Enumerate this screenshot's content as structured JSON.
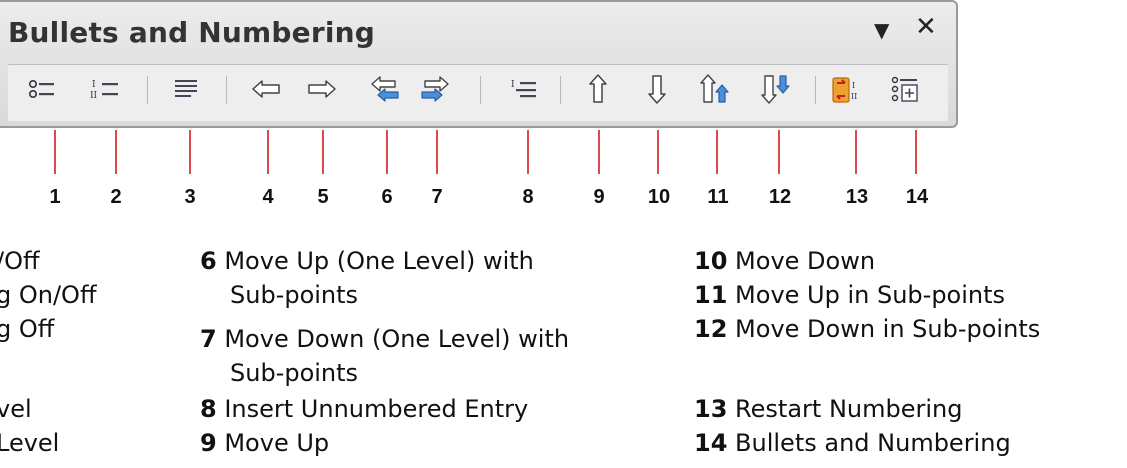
{
  "toolbar": {
    "title": "Bullets and Numbering",
    "menu_icon": "triangle-down-icon",
    "close_icon": "close-icon",
    "buttons": [
      {
        "num": "1",
        "icon": "bullets-icon"
      },
      {
        "num": "2",
        "icon": "numbering-icon"
      },
      {
        "num": "3",
        "icon": "numbering-off-icon"
      },
      {
        "num": "4",
        "icon": "arrow-left-icon"
      },
      {
        "num": "5",
        "icon": "arrow-right-icon"
      },
      {
        "num": "6",
        "icon": "move-up-level-subpoints-icon"
      },
      {
        "num": "7",
        "icon": "move-down-level-subpoints-icon"
      },
      {
        "num": "8",
        "icon": "insert-unnumbered-entry-icon"
      },
      {
        "num": "9",
        "icon": "arrow-up-icon"
      },
      {
        "num": "10",
        "icon": "arrow-down-icon"
      },
      {
        "num": "11",
        "icon": "move-up-subpoints-icon"
      },
      {
        "num": "12",
        "icon": "move-down-subpoints-icon"
      },
      {
        "num": "13",
        "icon": "restart-numbering-icon"
      },
      {
        "num": "14",
        "icon": "bullets-numbering-dialog-icon"
      }
    ]
  },
  "callout_color": "#d94a4a",
  "legend": {
    "col1": [
      {
        "text": "/Off"
      },
      {
        "text": "g On/Off"
      },
      {
        "text": "g Off"
      },
      {
        "text": "vel"
      },
      {
        "text": "Level"
      }
    ],
    "col2": [
      {
        "num": "6",
        "text": "Move Up (One Level) with",
        "cont": "Sub-points"
      },
      {
        "num": "7",
        "text": "Move Down (One Level) with",
        "cont": "Sub-points"
      },
      {
        "num": "8",
        "text": "Insert Unnumbered Entry"
      },
      {
        "num": "9",
        "text": "Move Up"
      }
    ],
    "col3": [
      {
        "num": "10",
        "text": "Move Down"
      },
      {
        "num": "11",
        "text": "Move Up in Sub-points"
      },
      {
        "num": "12",
        "text": "Move Down in Sub-points"
      },
      {
        "num": "13",
        "text": "Restart Numbering"
      },
      {
        "num": "14",
        "text": "Bullets and Numbering"
      }
    ]
  }
}
